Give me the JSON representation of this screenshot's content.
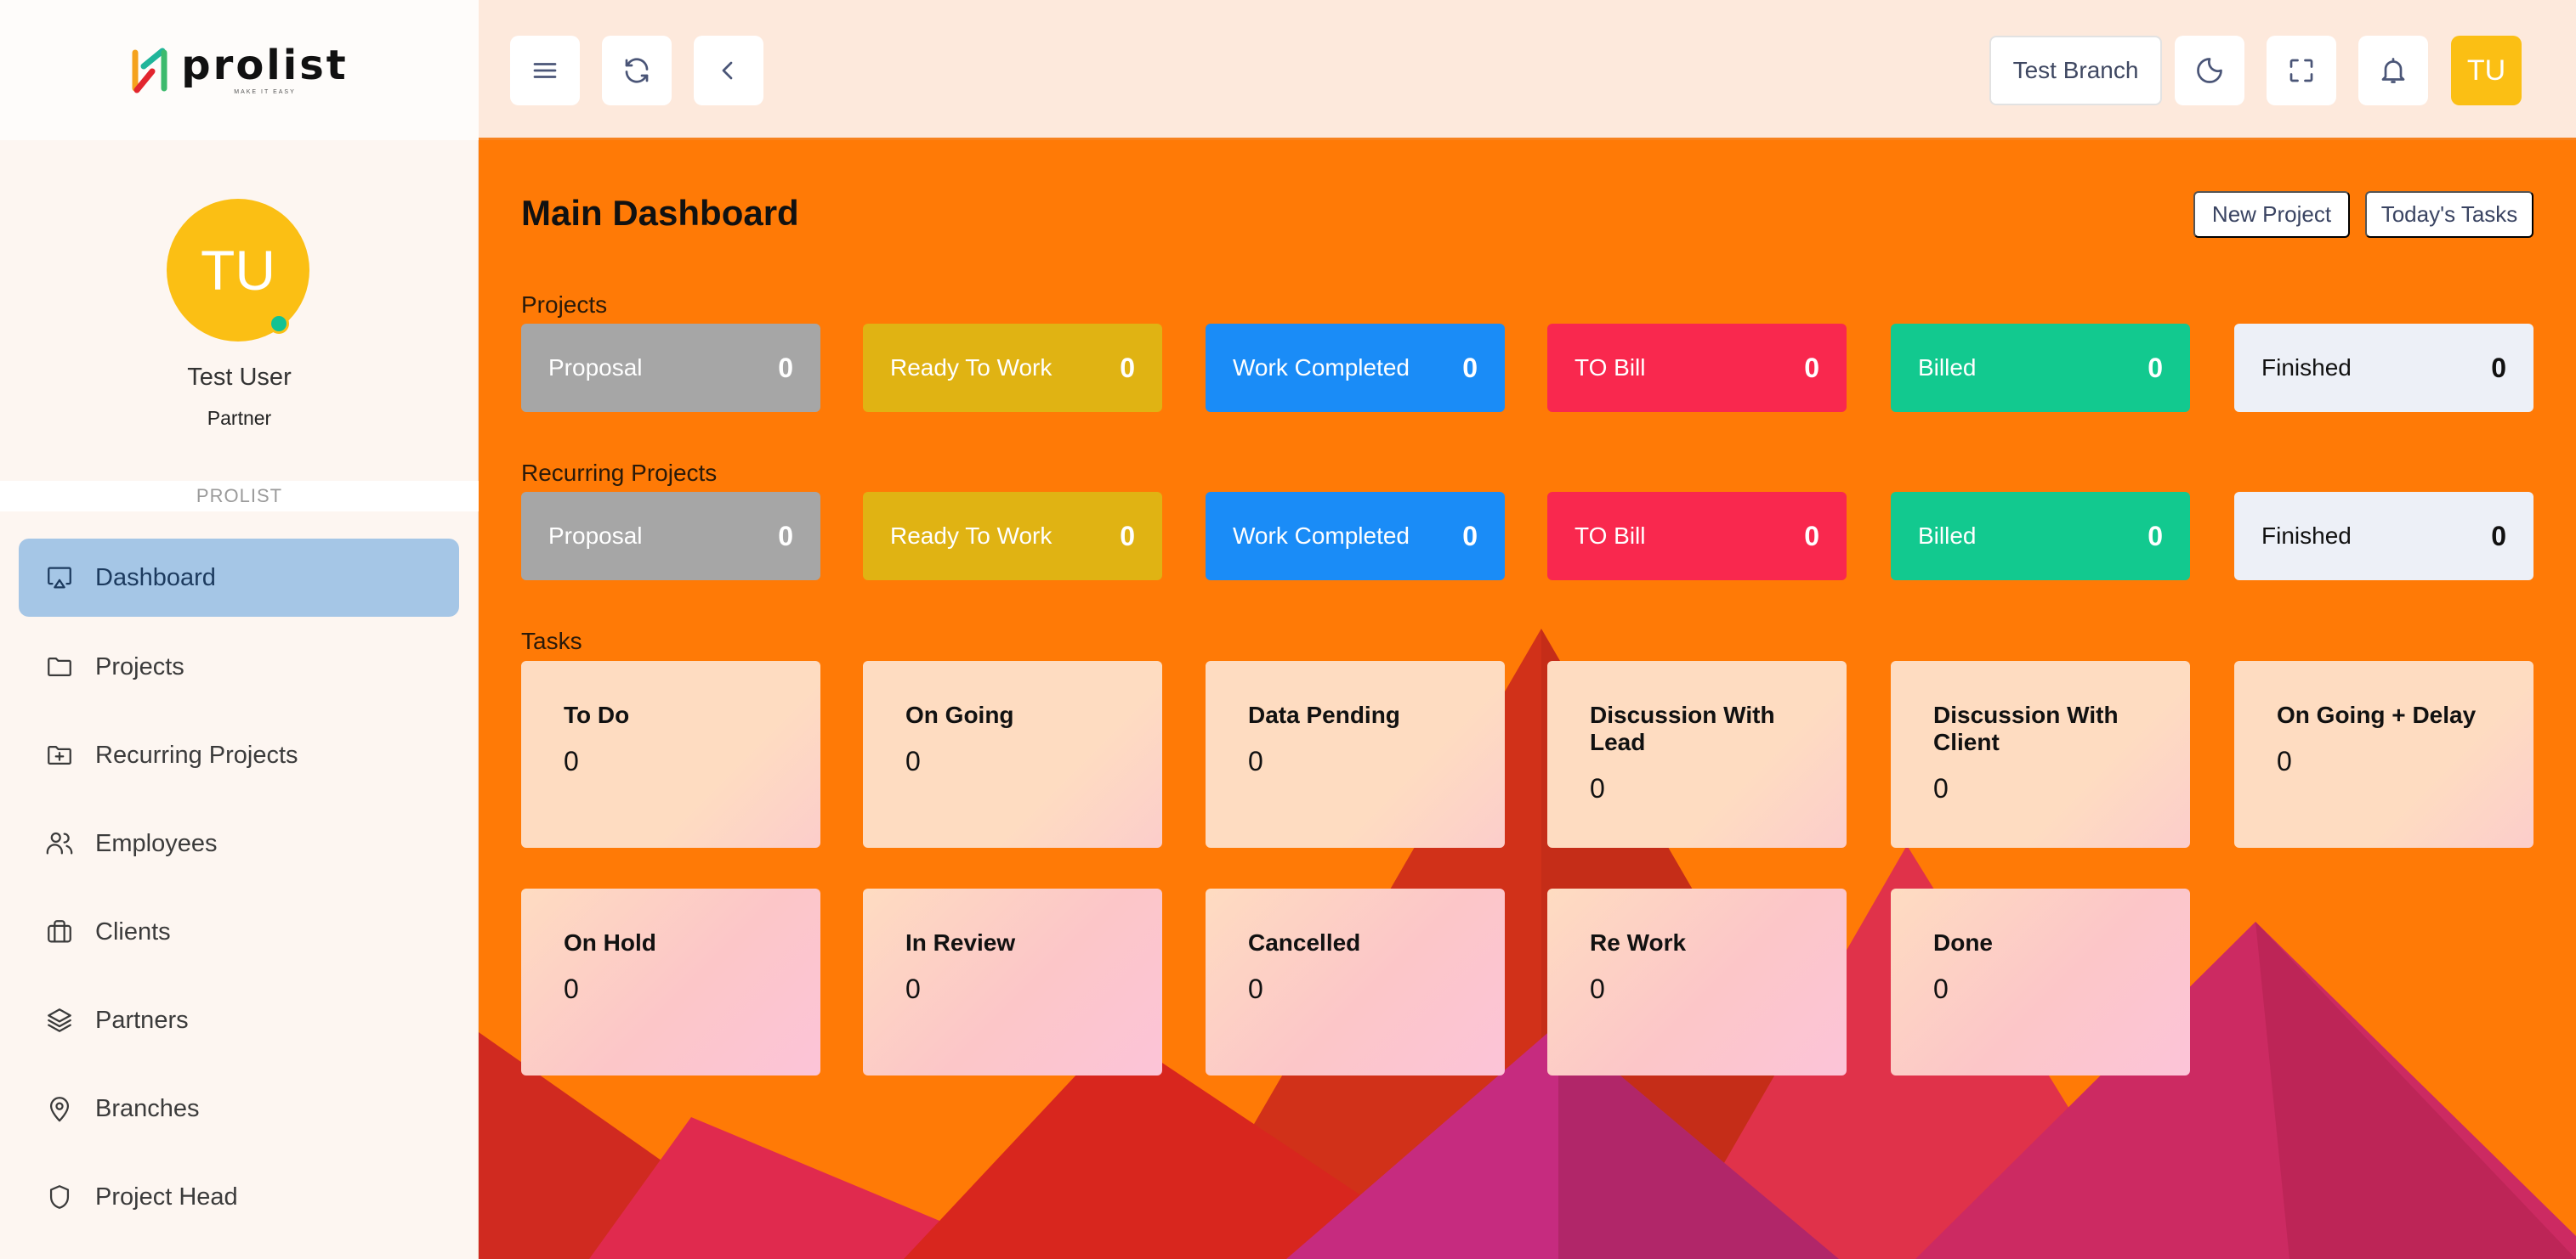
{
  "brand": {
    "name": "prolist",
    "tagline": "MAKE IT EASY"
  },
  "profile": {
    "initials": "TU",
    "name": "Test User",
    "role": "Partner",
    "status": "online"
  },
  "sidebar": {
    "section_title": "PROLIST",
    "items": [
      {
        "label": "Dashboard",
        "icon": "dashboard-icon",
        "active": true
      },
      {
        "label": "Projects",
        "icon": "folder-icon"
      },
      {
        "label": "Recurring Projects",
        "icon": "folder-plus-icon"
      },
      {
        "label": "Employees",
        "icon": "users-icon"
      },
      {
        "label": "Clients",
        "icon": "briefcase-icon"
      },
      {
        "label": "Partners",
        "icon": "layers-icon"
      },
      {
        "label": "Branches",
        "icon": "map-pin-icon"
      },
      {
        "label": "Project Head",
        "icon": "shield-icon"
      }
    ]
  },
  "header": {
    "menu_icon": "hamburger-icon",
    "refresh_icon": "refresh-icon",
    "back_icon": "chevron-left-icon",
    "branch_label": "Test Branch",
    "theme_icon": "moon-icon",
    "fullscreen_icon": "fullscreen-icon",
    "notifications_icon": "bell-icon",
    "user_initials": "TU"
  },
  "dashboard": {
    "title": "Main Dashboard",
    "new_project_label": "New Project",
    "todays_tasks_label": "Today's Tasks",
    "projects": {
      "label": "Projects",
      "cards": [
        {
          "label": "Proposal",
          "value": "0",
          "color": "#a6a6a6"
        },
        {
          "label": "Ready To Work",
          "value": "0",
          "color": "#e0b313"
        },
        {
          "label": "Work Completed",
          "value": "0",
          "color": "#1a8cf7"
        },
        {
          "label": "TO Bill",
          "value": "0",
          "color": "#f9284e"
        },
        {
          "label": "Billed",
          "value": "0",
          "color": "#12c98f"
        },
        {
          "label": "Finished",
          "value": "0",
          "color": "#edf0f7"
        }
      ]
    },
    "recurring_projects": {
      "label": "Recurring Projects",
      "cards": [
        {
          "label": "Proposal",
          "value": "0",
          "color": "#a6a6a6"
        },
        {
          "label": "Ready To Work",
          "value": "0",
          "color": "#e0b313"
        },
        {
          "label": "Work Completed",
          "value": "0",
          "color": "#1a8cf7"
        },
        {
          "label": "TO Bill",
          "value": "0",
          "color": "#f9284e"
        },
        {
          "label": "Billed",
          "value": "0",
          "color": "#12c98f"
        },
        {
          "label": "Finished",
          "value": "0",
          "color": "#edf0f7"
        }
      ]
    },
    "tasks": {
      "label": "Tasks",
      "cards": [
        {
          "label": "To Do",
          "value": "0"
        },
        {
          "label": "On Going",
          "value": "0"
        },
        {
          "label": "Data Pending",
          "value": "0"
        },
        {
          "label": "Discussion With Lead",
          "value": "0"
        },
        {
          "label": "Discussion With Client",
          "value": "0"
        },
        {
          "label": "On Going + Delay",
          "value": "0"
        },
        {
          "label": "On Hold",
          "value": "0"
        },
        {
          "label": "In Review",
          "value": "0"
        },
        {
          "label": "Cancelled",
          "value": "0"
        },
        {
          "label": "Re Work",
          "value": "0"
        },
        {
          "label": "Done",
          "value": "0"
        }
      ]
    }
  },
  "colors": {
    "accent": "#ff7a06",
    "sidebar_active": "#a5c6e6",
    "avatar": "#fbbf14",
    "online": "#12c293"
  }
}
